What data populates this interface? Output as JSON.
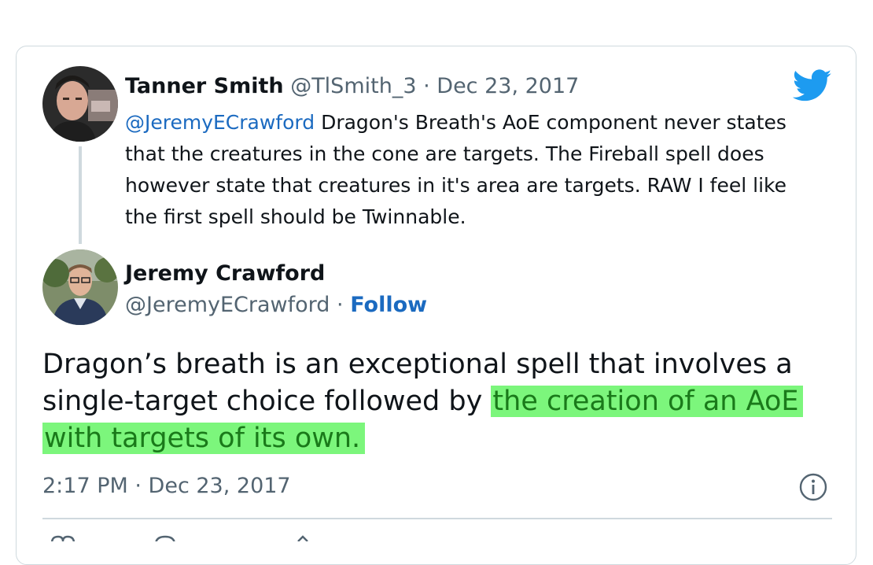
{
  "reply_tweet": {
    "author_name": "Tanner Smith",
    "author_handle": "@TlSmith_3",
    "separator": "·",
    "date": "Dec 23, 2017",
    "mention": "@JeremyECrawford",
    "text_line1": " Dragon's Breath's AoE component never states",
    "text_line2": "that the creatures in the cone are targets. The Fireball spell does",
    "text_line3": "however state that creatures in it's area are targets. RAW I feel like",
    "text_line4": "the first spell should be Twinnable."
  },
  "main_tweet": {
    "author_name": "Jeremy Crawford",
    "author_handle": "@JeremyECrawford",
    "separator": "·",
    "follow_label": "Follow",
    "text_line1": "Dragon’s breath is an exceptional spell that involves a",
    "text_line2_plain": "single-target choice followed by ",
    "text_line2_highlight": "the creation of an AoE ",
    "text_line3_highlight": "with targets of its own.",
    "highlight_color": "#7cf67c",
    "timestamp": "2:17 PM · Dec 23, 2017"
  },
  "colors": {
    "link_blue": "#1b6ac0",
    "twitter_blue": "#1d9bf0",
    "secondary_text": "#536471",
    "border": "#cfd9de"
  },
  "icons": {
    "brand": "twitter-bird-icon",
    "info": "info-circle-icon",
    "actions": [
      "heart-icon",
      "reply-icon",
      "share-icon"
    ]
  }
}
